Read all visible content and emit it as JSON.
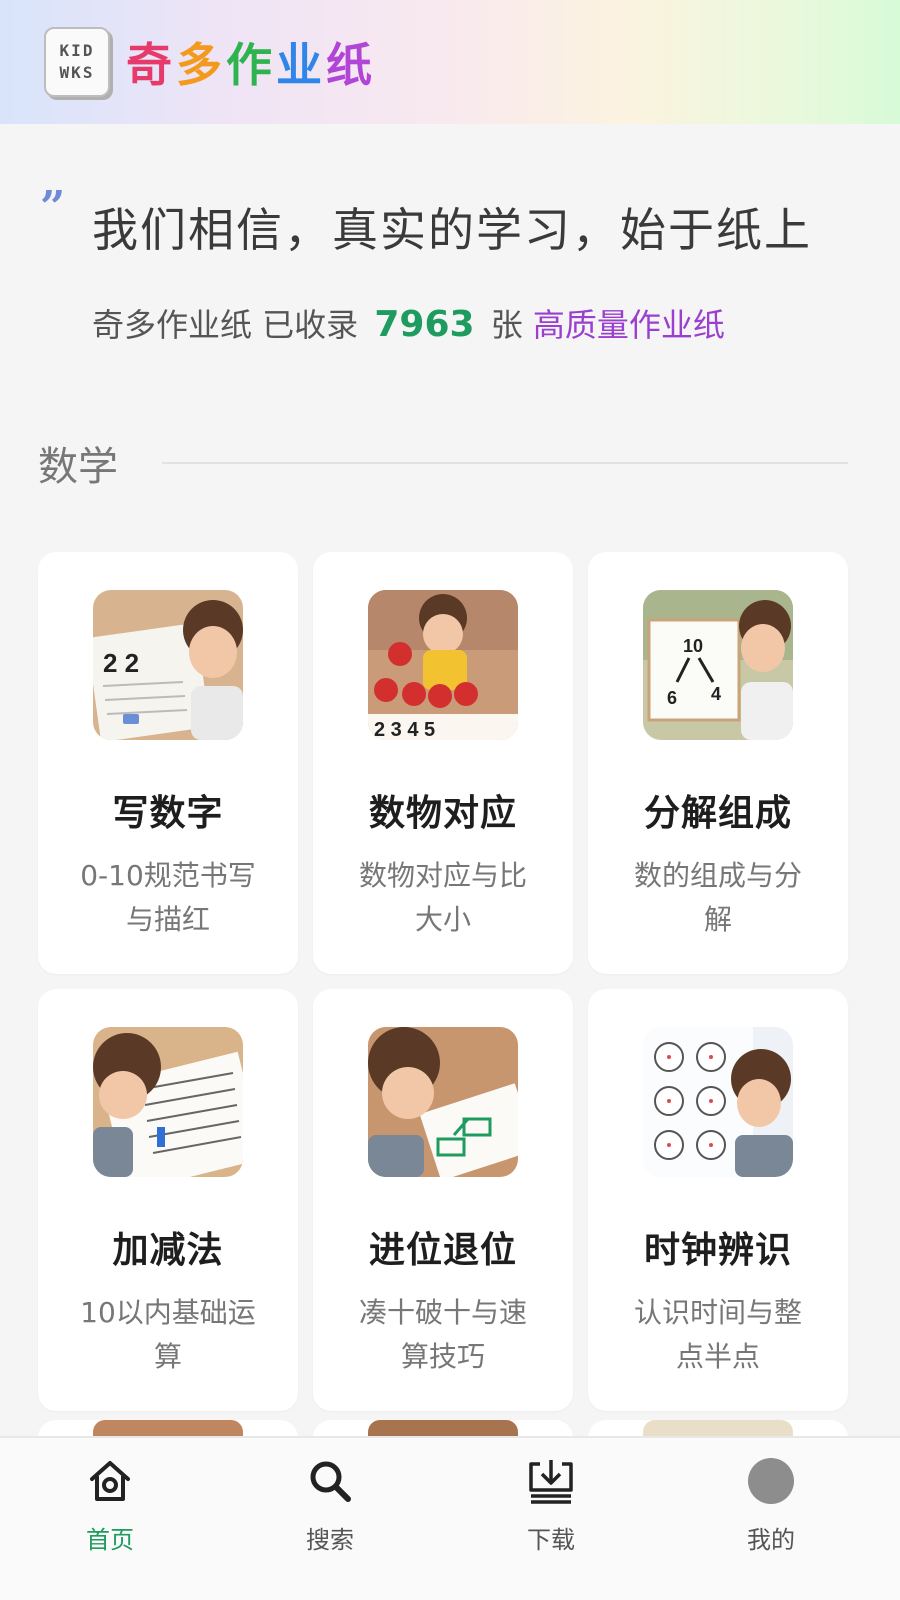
{
  "header": {
    "logo_line1": "KID",
    "logo_line2": "WKS",
    "brand_chars": [
      {
        "char": "奇",
        "color": "#e63a6b"
      },
      {
        "char": "多",
        "color": "#f39a1c"
      },
      {
        "char": "作",
        "color": "#2fb34f"
      },
      {
        "char": "业",
        "color": "#2f86e8"
      },
      {
        "char": "纸",
        "color": "#b146d6"
      }
    ]
  },
  "intro": {
    "quote_mark": "”",
    "headline": "我们相信，真实的学习，始于纸上",
    "stat_prefix": "奇多作业纸 已收录",
    "stat_count": "7963",
    "stat_unit": "张",
    "stat_suffix": "高质量作业纸"
  },
  "section": {
    "title": "数学"
  },
  "cards": [
    {
      "title": "写数字",
      "desc": "0-10规范书写与描红"
    },
    {
      "title": "数物对应",
      "desc": "数物对应与比大小"
    },
    {
      "title": "分解组成",
      "desc": "数的组成与分解"
    },
    {
      "title": "加减法",
      "desc": "10以内基础运算"
    },
    {
      "title": "进位退位",
      "desc": "凑十破十与速算技巧"
    },
    {
      "title": "时钟辨识",
      "desc": "认识时间与整点半点"
    }
  ],
  "nav": {
    "items": [
      {
        "label": "首页",
        "icon": "home-icon",
        "active": true
      },
      {
        "label": "搜索",
        "icon": "search-icon",
        "active": false
      },
      {
        "label": "下载",
        "icon": "download-icon",
        "active": false
      },
      {
        "label": "我的",
        "icon": "avatar-icon",
        "active": false
      }
    ]
  },
  "colors": {
    "accent": "#1e9b5e",
    "highlight": "#9a3fd0"
  }
}
